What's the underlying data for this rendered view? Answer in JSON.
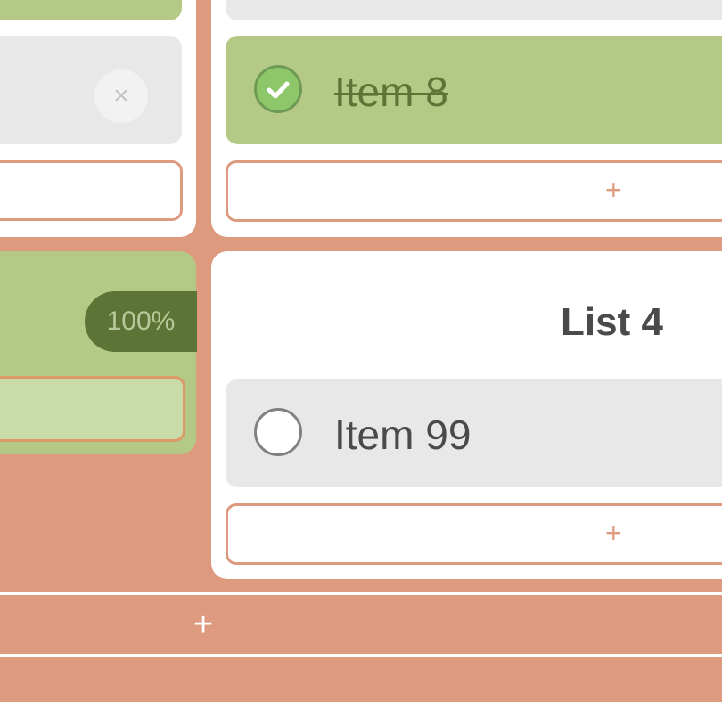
{
  "lists": [
    {
      "completion": "100%"
    },
    {
      "items": [
        {
          "label": "Item 8",
          "checked": true
        }
      ],
      "add_item_label": "+"
    },
    {
      "title": "List 4",
      "items": [
        {
          "label": "Item 99",
          "checked": false
        }
      ],
      "add_item_label": "+"
    }
  ],
  "left_top": {
    "delete_label": "×"
  },
  "add_list_label": "+",
  "colors": {
    "background": "#dd9a7e",
    "card": "#ffffff",
    "done_green": "#b4c986",
    "dark_green": "#5c7536",
    "item_gray": "#e8e8e8",
    "text": "#4a4a4a"
  },
  "icons": {
    "checked": "check-icon",
    "unchecked": "empty-circle-icon",
    "delete": "close-icon",
    "add": "plus-icon"
  }
}
